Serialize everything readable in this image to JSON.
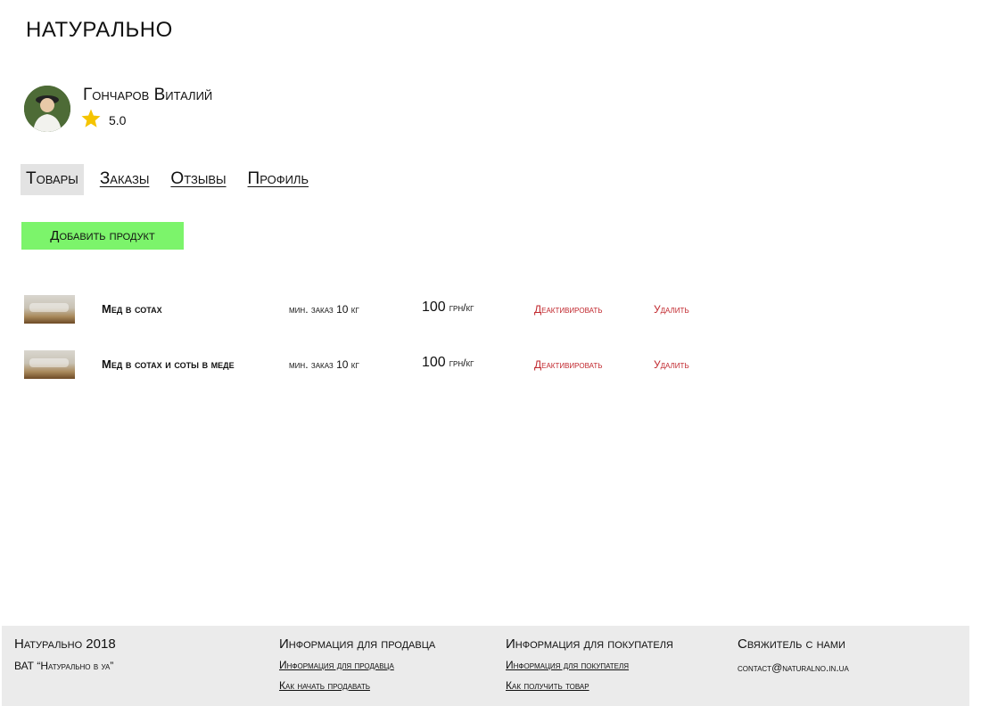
{
  "site": {
    "logo": "НАТУРАЛЬНО"
  },
  "seller": {
    "name": "Гончаров Виталий",
    "rating": "5.0",
    "avatar_icon": "user-photo"
  },
  "tabs": [
    {
      "label": "Товары",
      "active": true
    },
    {
      "label": "Заказы",
      "active": false
    },
    {
      "label": "Отзывы",
      "active": false
    },
    {
      "label": "Профиль",
      "active": false
    }
  ],
  "add_button": {
    "label": "Добавить продукт"
  },
  "products": [
    {
      "name": "Мед в сотах",
      "min_order": "мин. заказ 10 кг",
      "price": "100",
      "unit": "грн/кг",
      "deactivate": "Деактивировать",
      "delete": "Удалить"
    },
    {
      "name": "Мед в сотах и соты в меде",
      "min_order": "мин. заказ 10 кг",
      "price": "100",
      "unit": "грн/кг",
      "deactivate": "Деактивировать",
      "delete": "Удалить"
    }
  ],
  "footer": {
    "col1": {
      "title": "Натурально 2018",
      "text": "ВАТ “Натурально в уа”"
    },
    "col2": {
      "title": "Информация для продавца",
      "links": [
        "Информация для продавца",
        "Как начать продавать"
      ]
    },
    "col3": {
      "title": "Информация для покупателя",
      "links": [
        "Информация для покупателя",
        "Как получить товар"
      ]
    },
    "col4": {
      "title": "Свяжитель с нами",
      "text": "contact@naturalno.in.ua"
    }
  },
  "colors": {
    "accent_button": "#7cf46b",
    "danger": "#c1272d",
    "footer_bg": "#ebebeb",
    "star": "#f5c400"
  }
}
